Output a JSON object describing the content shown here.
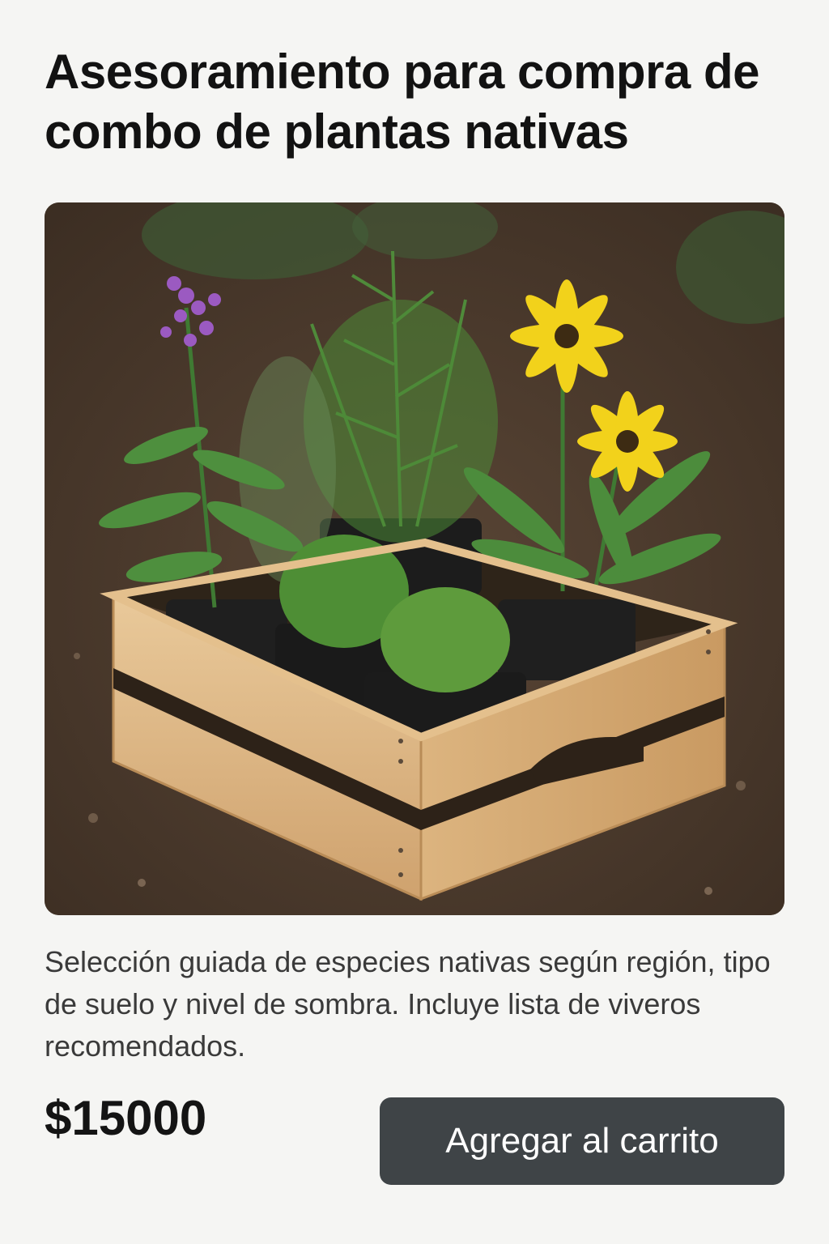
{
  "product": {
    "title": "Asesoramiento para compra de combo de plantas nativas",
    "image_alt": "Caja de madera con plantas nativas en macetas",
    "description": "Selección guiada de especies nativas según región, tipo de suelo y nivel de sombra. Incluye lista de viveros recomendados.",
    "price": "$15000",
    "add_to_cart_label": "Agregar al carrito"
  },
  "colors": {
    "page_background": "#f5f5f3",
    "button_background": "#3f4447",
    "button_text": "#ffffff",
    "title_text": "#121212",
    "description_text": "#3a3a3a"
  }
}
